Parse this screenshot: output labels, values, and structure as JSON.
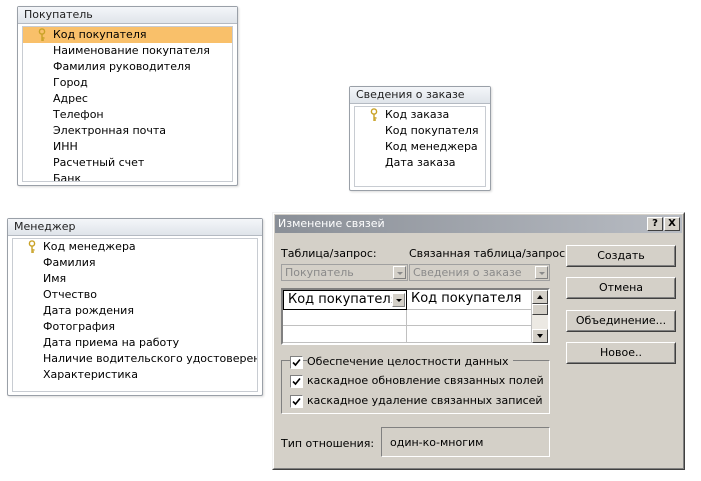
{
  "tables": {
    "customer": {
      "title": "Покупатель",
      "fields": [
        "Код покупателя",
        "Наименование покупателя",
        "Фамилия руководителя",
        "Город",
        "Адрес",
        "Телефон",
        "Электронная почта",
        "ИНН",
        "Расчетный счет",
        "Банк"
      ]
    },
    "order": {
      "title": "Сведения о заказе",
      "fields": [
        "Код заказа",
        "Код покупателя",
        "Код менеджера",
        "Дата заказа"
      ]
    },
    "manager": {
      "title": "Менеджер",
      "fields": [
        "Код менеджера",
        "Фамилия",
        "Имя",
        "Отчество",
        "Дата рождения",
        "Фотография",
        "Дата приема на работу",
        "Наличие водительского удостоверения",
        "Характеристика"
      ]
    }
  },
  "dialog": {
    "title": "Изменение связей",
    "help_label": "?",
    "close_label": "X",
    "table_label": "Таблица/запрос:",
    "related_label": "Связанная таблица/запрос:",
    "table_value": "Покупатель",
    "related_value": "Сведения о заказе",
    "grid": {
      "left_field": "Код покупателя",
      "right_field": "Код покупателя"
    },
    "checkboxes": [
      {
        "label": "Обеспечение целостности данных",
        "checked": true
      },
      {
        "label": "каскадное обновление связанных полей",
        "checked": true
      },
      {
        "label": "каскадное удаление связанных записей",
        "checked": true
      }
    ],
    "relation_type_label": "Тип отношения:",
    "relation_type_value": "один-ко-многим",
    "buttons": {
      "create": "Создать",
      "cancel": "Отмена",
      "join": "Объединение...",
      "new": "Новое.."
    }
  },
  "colors": {
    "selected_row": "#f9c06a",
    "key_icon": "#c9a227",
    "dialog_face": "#d4d0c8"
  }
}
